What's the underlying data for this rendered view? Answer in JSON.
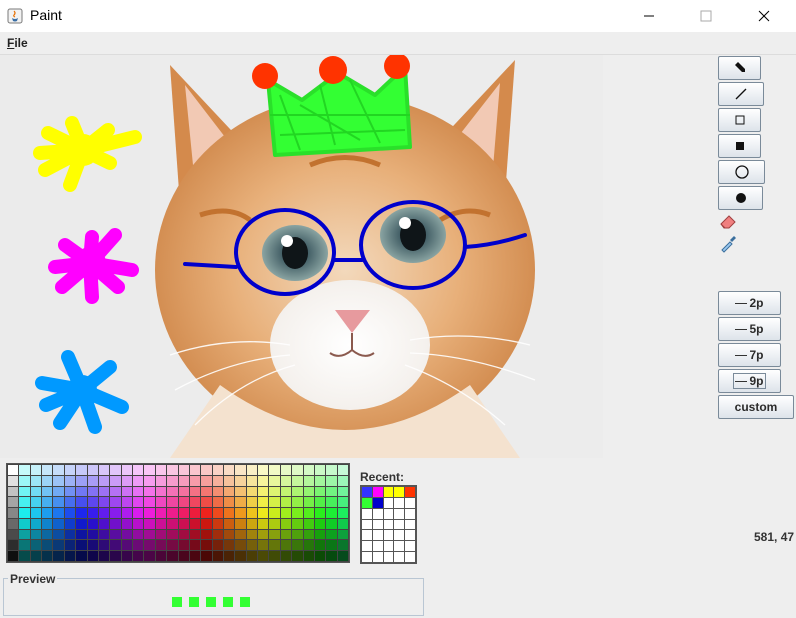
{
  "window": {
    "title": "Paint"
  },
  "menu": {
    "file_mnemonic": "F",
    "file_rest": "ile"
  },
  "tools": [
    {
      "name": "pencil",
      "icon": "pencil-icon"
    },
    {
      "name": "line",
      "icon": "line-icon"
    },
    {
      "name": "rectangle",
      "icon": "rectangle-outline-icon"
    },
    {
      "name": "filled-rectangle",
      "icon": "rectangle-filled-icon"
    },
    {
      "name": "oval",
      "icon": "oval-outline-icon"
    },
    {
      "name": "filled-oval",
      "icon": "oval-filled-icon"
    },
    {
      "name": "eraser",
      "icon": "eraser-icon"
    },
    {
      "name": "eyedropper",
      "icon": "eyedropper-icon"
    }
  ],
  "strokes": [
    "2p",
    "5p",
    "7p",
    "9p"
  ],
  "stroke_selected": "9p",
  "custom_label": "custom",
  "recent_label": "Recent:",
  "recent_colors": [
    "#3333ff",
    "#ff00ff",
    "#ffff00",
    "#ffff00",
    "#ff3300",
    "#33ff33",
    "#0000cc"
  ],
  "coordinates": "581, 47",
  "preview_label": "Preview",
  "current_color": "#33ff33",
  "paint_colors": {
    "crown": "#33ff33",
    "crown_balls": "#ff3300",
    "glasses": "#0000cc",
    "splat_yellow": "#ffff00",
    "splat_magenta": "#ff00ff",
    "splat_blue": "#0099ff"
  }
}
